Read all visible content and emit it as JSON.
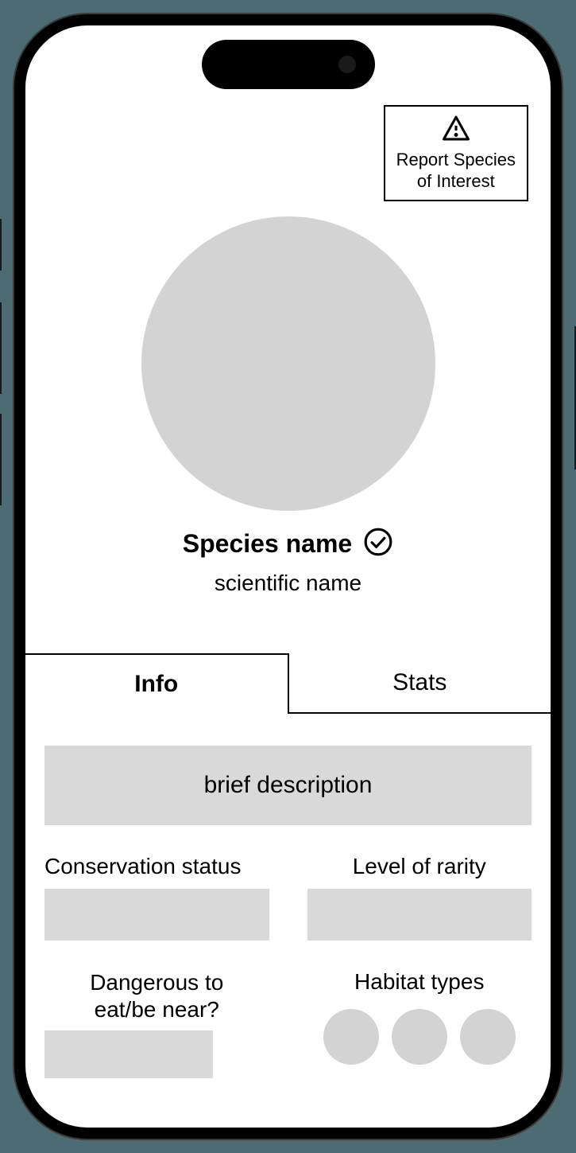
{
  "report_button": {
    "line1": "Report Species",
    "line2": "of Interest"
  },
  "species": {
    "name": "Species name",
    "scientific": "scientific name"
  },
  "tabs": {
    "info": "Info",
    "stats": "Stats"
  },
  "info": {
    "description_placeholder": "brief description",
    "conservation_label": "Conservation status",
    "rarity_label": "Level of rarity",
    "danger_label_line1": "Dangerous to",
    "danger_label_line2": "eat/be near?",
    "habitat_label": "Habitat types"
  }
}
